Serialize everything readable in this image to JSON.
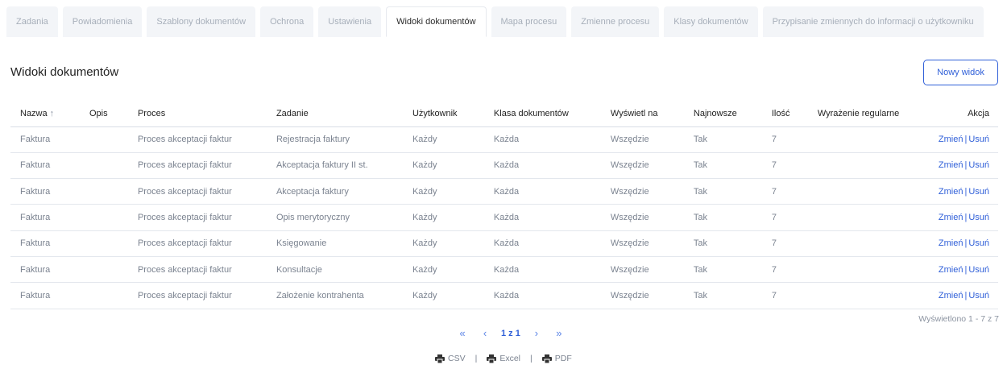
{
  "tabs": [
    {
      "label": "Zadania",
      "active": false
    },
    {
      "label": "Powiadomienia",
      "active": false
    },
    {
      "label": "Szablony dokumentów",
      "active": false
    },
    {
      "label": "Ochrona",
      "active": false
    },
    {
      "label": "Ustawienia",
      "active": false
    },
    {
      "label": "Widoki dokumentów",
      "active": true
    },
    {
      "label": "Mapa procesu",
      "active": false
    },
    {
      "label": "Zmienne procesu",
      "active": false
    },
    {
      "label": "Klasy dokumentów",
      "active": false
    },
    {
      "label": "Przypisanie zmiennych do informacji o użytkowniku",
      "active": false
    }
  ],
  "page": {
    "title": "Widoki dokumentów",
    "new_button": "Nowy widok"
  },
  "table": {
    "columns": [
      "Nazwa",
      "Opis",
      "Proces",
      "Zadanie",
      "Użytkownik",
      "Klasa dokumentów",
      "Wyświetl na",
      "Najnowsze",
      "Ilość",
      "Wyrażenie regularne",
      "Akcja"
    ],
    "sort_arrow": "↑",
    "action_edit": "Zmień",
    "action_sep": "|",
    "action_delete": "Usuń",
    "rows": [
      [
        "Faktura",
        "",
        "Proces akceptacji faktur",
        "Rejestracja faktury",
        "Każdy",
        "Każda",
        "Wszędzie",
        "Tak",
        "7",
        ""
      ],
      [
        "Faktura",
        "",
        "Proces akceptacji faktur",
        "Akceptacja faktury II st.",
        "Każdy",
        "Każda",
        "Wszędzie",
        "Tak",
        "7",
        ""
      ],
      [
        "Faktura",
        "",
        "Proces akceptacji faktur",
        "Akceptacja faktury",
        "Każdy",
        "Każda",
        "Wszędzie",
        "Tak",
        "7",
        ""
      ],
      [
        "Faktura",
        "",
        "Proces akceptacji faktur",
        "Opis merytoryczny",
        "Każdy",
        "Każda",
        "Wszędzie",
        "Tak",
        "7",
        ""
      ],
      [
        "Faktura",
        "",
        "Proces akceptacji faktur",
        "Księgowanie",
        "Każdy",
        "Każda",
        "Wszędzie",
        "Tak",
        "7",
        ""
      ],
      [
        "Faktura",
        "",
        "Proces akceptacji faktur",
        "Konsultacje",
        "Każdy",
        "Każda",
        "Wszędzie",
        "Tak",
        "7",
        ""
      ],
      [
        "Faktura",
        "",
        "Proces akceptacji faktur",
        "Założenie kontrahenta",
        "Każdy",
        "Każda",
        "Wszędzie",
        "Tak",
        "7",
        ""
      ]
    ]
  },
  "footer": {
    "shown_text": "Wyświetlono 1 - 7 z 7",
    "pagination": {
      "first": "«",
      "prev": "‹",
      "page_text": "1 z 1",
      "next": "›",
      "last": "»"
    },
    "exports": {
      "csv": "CSV",
      "excel": "Excel",
      "pdf": "PDF",
      "separator": "|"
    }
  },
  "colors": {
    "accent": "#2f5fd8",
    "tab_bg": "#f3f5f8",
    "muted_text": "#7b8390"
  },
  "icons": {
    "sort": "arrow-up-icon",
    "export": "printer-icon"
  }
}
